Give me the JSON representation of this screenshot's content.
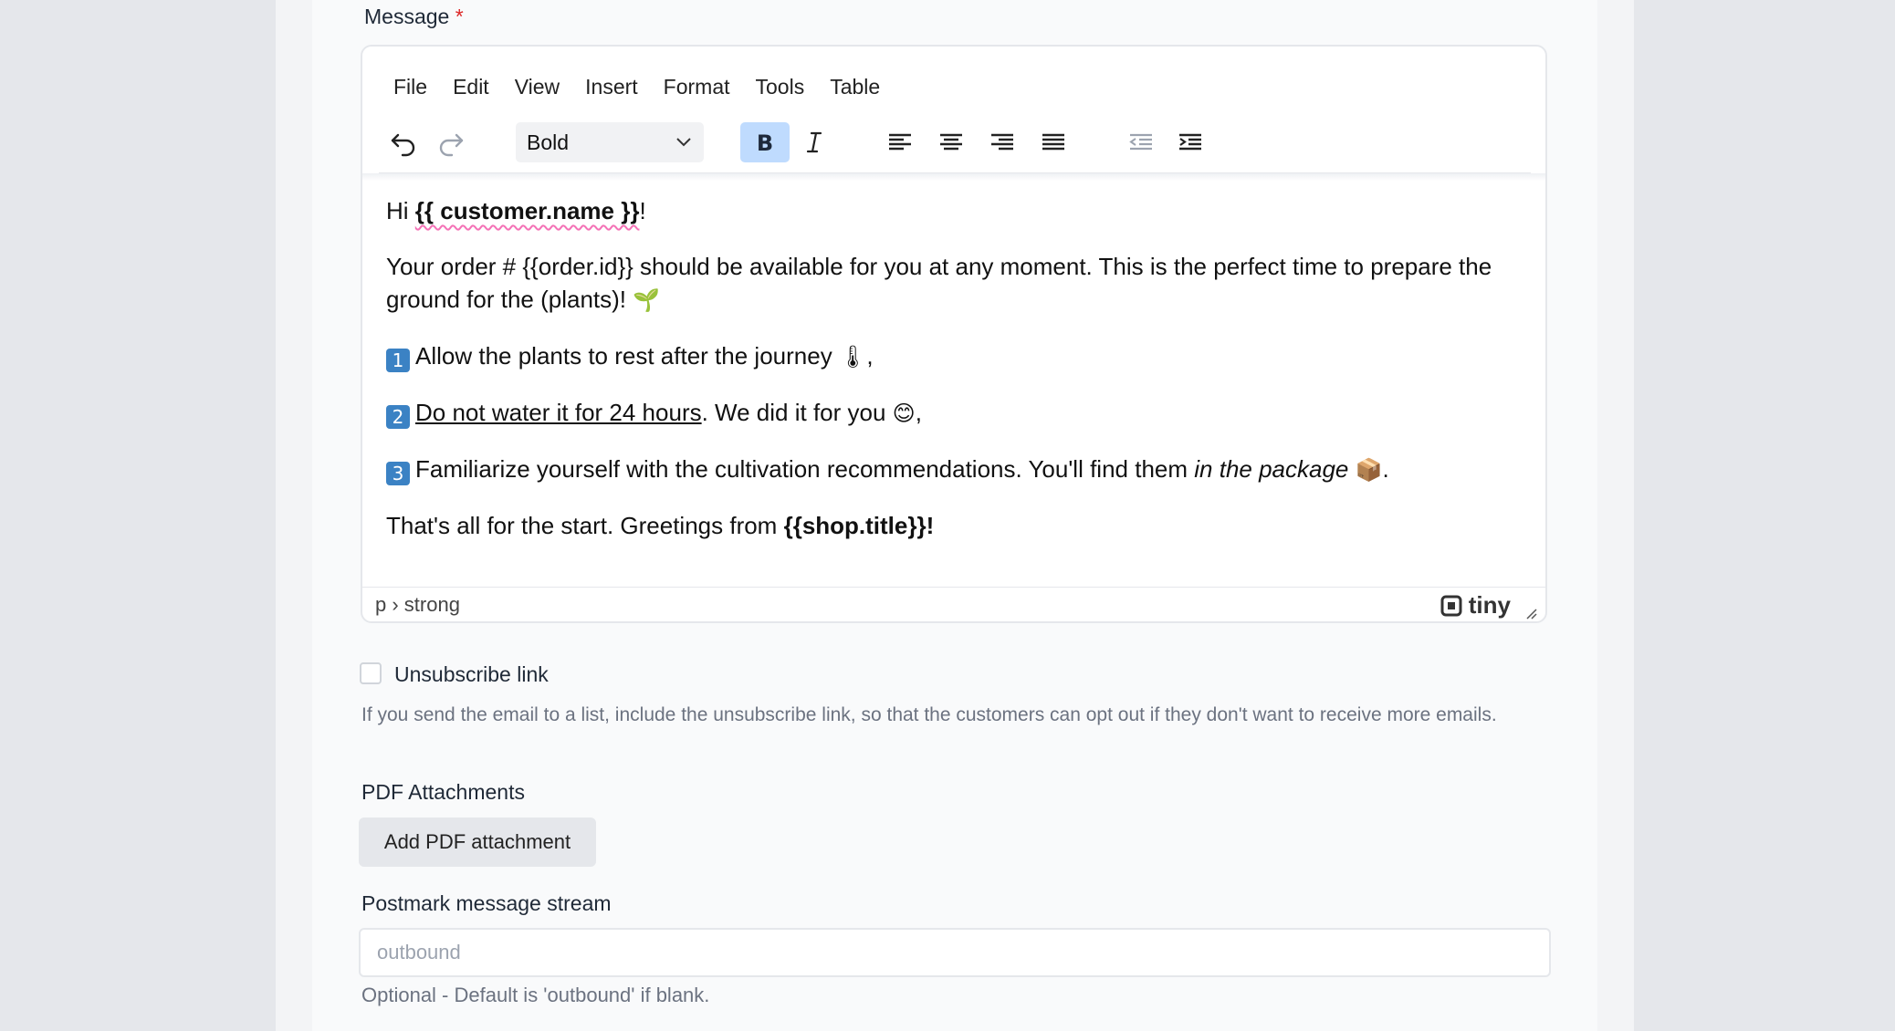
{
  "message": {
    "label": "Message",
    "required_mark": "*"
  },
  "editor": {
    "menu": [
      "File",
      "Edit",
      "View",
      "Insert",
      "Format",
      "Tools",
      "Table"
    ],
    "block_format": "Bold",
    "content": {
      "p1": {
        "a": "Hi ",
        "b": "{{ customer.name }}",
        "c": "!"
      },
      "p2": {
        "a": "Your order # {{order.id}} should be available for you at any moment. This is the perfect time to prepare the ground for the (plants)! ",
        "emoji": "🌱"
      },
      "p3": {
        "num": "1",
        "a": "Allow the plants to rest after the journey ",
        "emoji": "🌡",
        "b": ","
      },
      "p4": {
        "num": "2",
        "u": "Do not water it for 24 hours",
        "a": ". We did it for you ",
        "emoji": "😊",
        "b": ","
      },
      "p5": {
        "num": "3",
        "a": "Familiarize yourself with the cultivation recommendations. You'll find them ",
        "i": "in the package",
        "emoji": "📦",
        "b": "."
      },
      "p6": {
        "a": "That's all for the start. Greetings from ",
        "b": "{{shop.title}}!"
      }
    },
    "status_path": "p › strong",
    "brand": "tiny"
  },
  "unsubscribe": {
    "label": "Unsubscribe link",
    "help": "If you send the email to a list, include the unsubscribe link, so that the customers can opt out if they don't want to receive more emails."
  },
  "pdf": {
    "label": "PDF Attachments",
    "button": "Add PDF attachment"
  },
  "stream": {
    "label": "Postmark message stream",
    "placeholder": "outbound",
    "hint": "Optional - Default is 'outbound' if blank."
  },
  "colors": {
    "active_button": "#bfdbfe",
    "required": "#dc2626",
    "keycap": "#3b82c4"
  }
}
